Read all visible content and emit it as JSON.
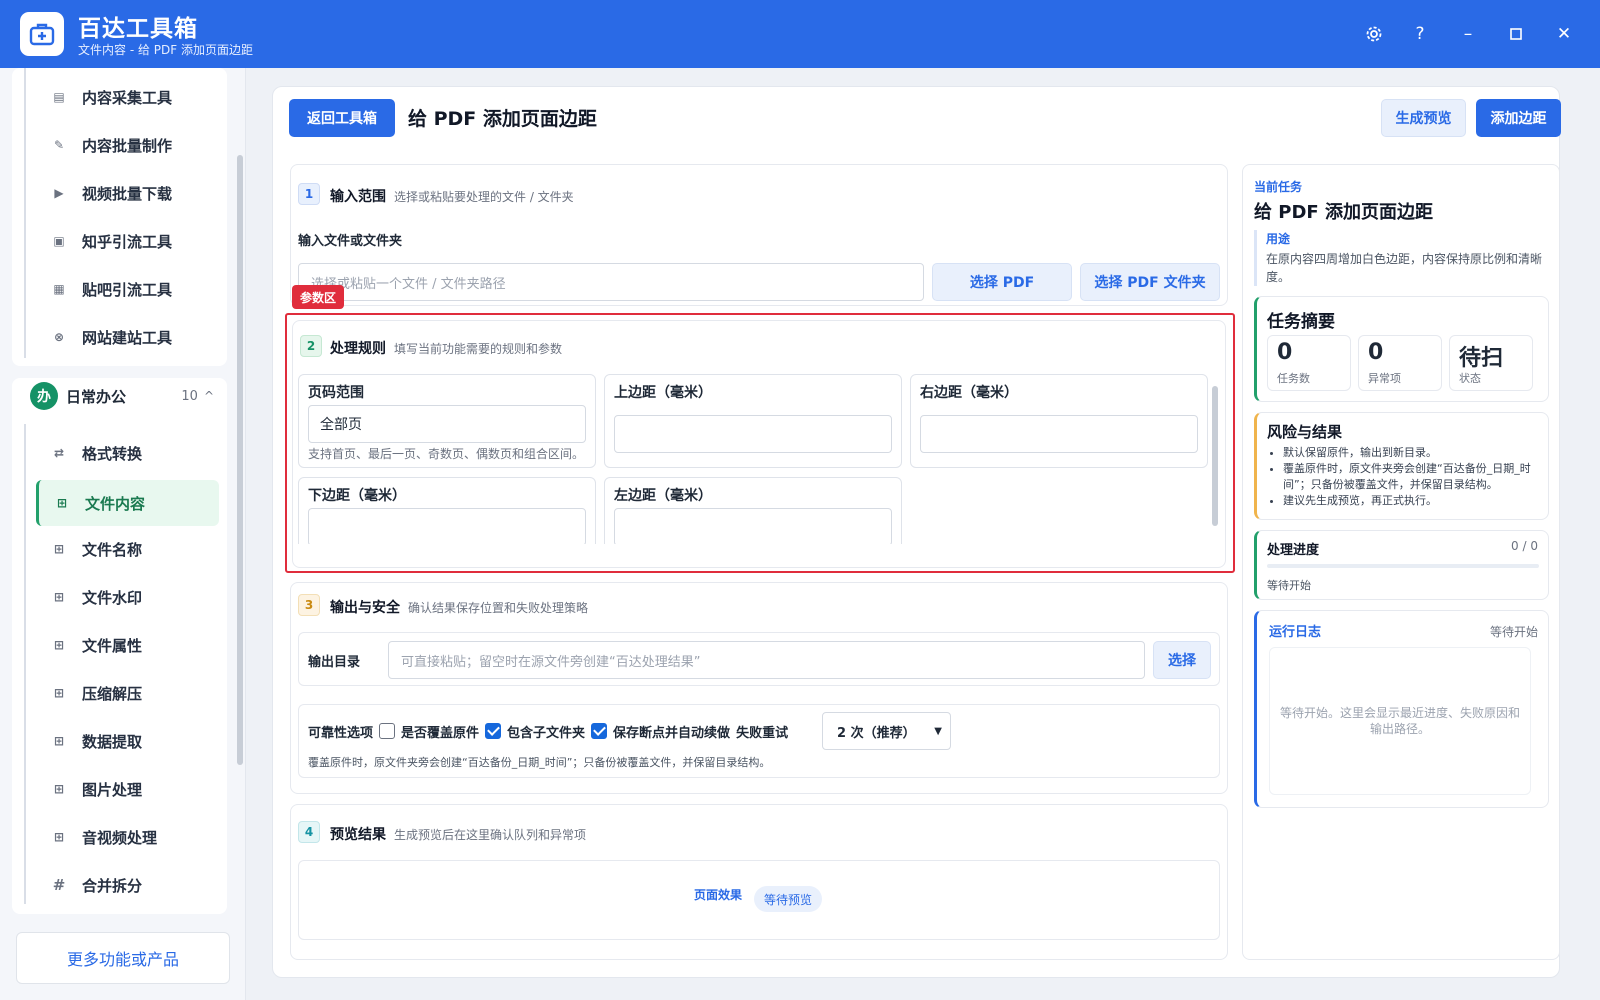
{
  "app": {
    "title": "百达工具箱",
    "subtitle": "文件内容 - 给 PDF 添加页面边距",
    "window_controls": [
      "gear-icon",
      "help-icon",
      "minimize-icon",
      "maximize-icon",
      "close-icon"
    ]
  },
  "sidebar": {
    "top_items": [
      {
        "label": "内容采集工具",
        "icon": "clipboard-icon"
      },
      {
        "label": "内容批量制作",
        "icon": "pen-icon"
      },
      {
        "label": "视频批量下载",
        "icon": "video-icon"
      },
      {
        "label": "知乎引流工具",
        "icon": "zhihu-icon"
      },
      {
        "label": "贴吧引流工具",
        "icon": "forum-icon"
      },
      {
        "label": "网站建站工具",
        "icon": "globe-icon"
      }
    ],
    "group": {
      "badge": "办",
      "title": "日常办公",
      "count": "10",
      "caret": "^"
    },
    "group_items": [
      {
        "label": "格式转换",
        "icon": "swap-icon"
      },
      {
        "label": "文件内容",
        "icon": "grid-icon",
        "active": true
      },
      {
        "label": "文件名称",
        "icon": "grid-icon"
      },
      {
        "label": "文件水印",
        "icon": "grid-icon"
      },
      {
        "label": "文件属性",
        "icon": "grid-icon"
      },
      {
        "label": "压缩解压",
        "icon": "grid-icon"
      },
      {
        "label": "数据提取",
        "icon": "grid-icon"
      },
      {
        "label": "图片处理",
        "icon": "grid-icon"
      },
      {
        "label": "音视频处理",
        "icon": "grid-icon"
      },
      {
        "label": "合并拆分",
        "icon": "hash-icon"
      }
    ],
    "more_button": "更多功能或产品"
  },
  "header": {
    "back_button": "返回工具箱",
    "title": "给 PDF 添加页面边距",
    "preview_button": "生成预览",
    "action_button": "添加边距"
  },
  "section1": {
    "step": "1",
    "title": "输入范围",
    "desc": "选择或粘贴要处理的文件 / 文件夹",
    "field_label": "输入文件或文件夹",
    "placeholder": "选择或粘贴一个文件 / 文件夹路径",
    "btn_pdf": "选择 PDF",
    "btn_folder": "选择 PDF 文件夹"
  },
  "section2": {
    "tag": "参数区",
    "step": "2",
    "title": "处理规则",
    "desc": "填写当前功能需要的规则和参数",
    "fields": [
      {
        "label": "页码范围",
        "value": "全部页",
        "hint": "支持首页、最后一页、奇数页、偶数页和组合区间。"
      },
      {
        "label": "上边距（毫米）",
        "value": ""
      },
      {
        "label": "右边距（毫米）",
        "value": ""
      },
      {
        "label": "下边距（毫米）",
        "value": ""
      },
      {
        "label": "左边距（毫米）",
        "value": ""
      }
    ]
  },
  "section3": {
    "step": "3",
    "title": "输出与安全",
    "desc": "确认结果保存位置和失败处理策略",
    "output_label": "输出目录",
    "output_placeholder": "可直接粘贴；留空时在源文件旁创建“百达处理结果”",
    "output_button": "选择",
    "reliability_label": "可靠性选项",
    "opt_overwrite": "是否覆盖原件",
    "opt_subfolders": "包含子文件夹",
    "opt_resume": "保存断点并自动续做",
    "retry_label": "失败重试",
    "retry_value": "2 次（推荐）",
    "note": "覆盖原件时，原文件夹旁会创建“百达备份_日期_时间”；只备份被覆盖文件，并保留目录结构。",
    "opt_overwrite_checked": false,
    "opt_subfolders_checked": true,
    "opt_resume_checked": true
  },
  "section4": {
    "step": "4",
    "title": "预览结果",
    "desc": "生成预览后在这里确认队列和异常项",
    "preview_label": "页面效果",
    "preview_badge": "等待预览"
  },
  "task": {
    "kicker": "当前任务",
    "title": "给 PDF 添加页面边距",
    "use_label": "用途",
    "use_text": "在原内容四周增加白色边距，内容保持原比例和清晰度。"
  },
  "summary": {
    "title": "任务摘要",
    "stats": [
      {
        "value": "0",
        "label": "任务数"
      },
      {
        "value": "0",
        "label": "异常项"
      },
      {
        "value": "待扫",
        "label": "状态"
      }
    ]
  },
  "risk": {
    "title": "风险与结果",
    "items": [
      "默认保留原件，输出到新目录。",
      "覆盖原件时，原文件夹旁会创建“百达备份_日期_时间”；只备份被覆盖文件，并保留目录结构。",
      "建议先生成预览，再正式执行。"
    ]
  },
  "progress": {
    "title": "处理进度",
    "count": "0 / 0",
    "fraction": 0,
    "status": "等待开始"
  },
  "log": {
    "title": "运行日志",
    "status": "等待开始",
    "placeholder": "等待开始。这里会显示最近进度、失败原因和输出路径。"
  },
  "colors": {
    "primary": "#2a6ae6",
    "active_green": "#22a06b",
    "highlight_red": "#e02d3c",
    "risk_amber": "#f0b44c"
  }
}
